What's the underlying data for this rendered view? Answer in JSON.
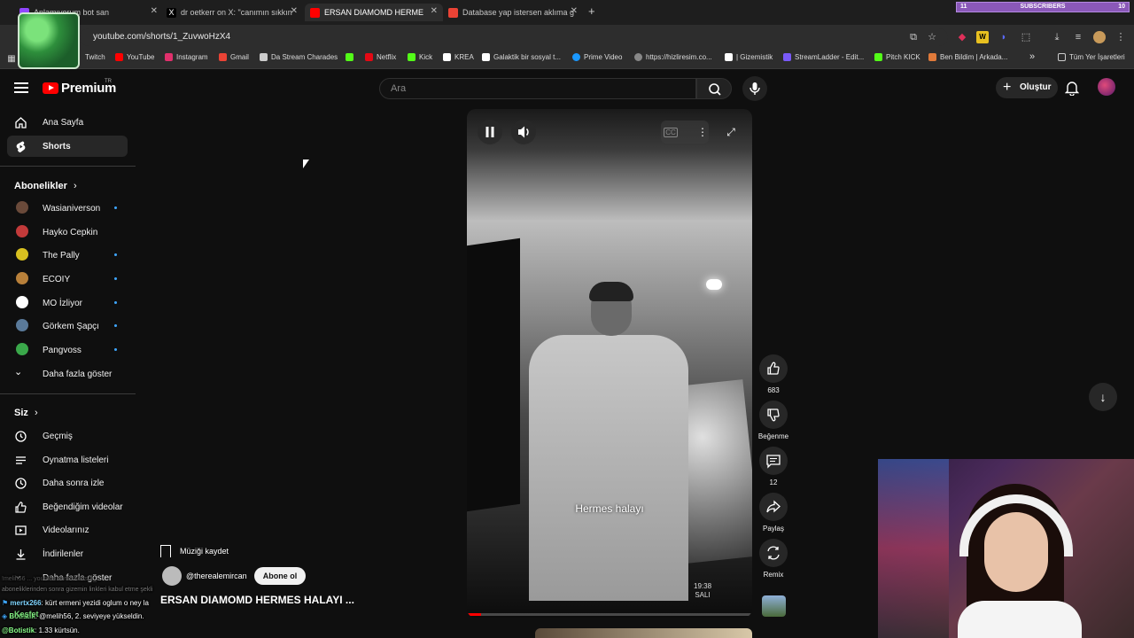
{
  "browser": {
    "tabs": [
      {
        "title": "Anlamıyorum bot san",
        "x": 0
      },
      {
        "title": "dr oetkerr on X: \"canımın sıkkın",
        "x": 0
      },
      {
        "title": "ERSAN DIAMOMD HERME",
        "x": 0
      },
      {
        "title": "Database yap istersen aklıma g",
        "x": 0
      }
    ],
    "new_tab": "+",
    "subscribers_label": "SUBSCRIBERS",
    "subscribers_left": "11",
    "subscribers_right": "10",
    "url": "youtube.com/shorts/1_ZuvwoHzX4",
    "bookmarks": [
      {
        "label": "Twitch",
        "color": "#9146ff"
      },
      {
        "label": "YouTube",
        "color": "#ff0000"
      },
      {
        "label": "Instagram",
        "color": "#e1306c"
      },
      {
        "label": "Gmail",
        "color": "#ea4335"
      },
      {
        "label": "Da Stream Charades",
        "color": "#cccccc"
      },
      {
        "label": "",
        "color": "#53fc18"
      },
      {
        "label": "Netflix",
        "color": "#e50914"
      },
      {
        "label": "Kick",
        "color": "#53fc18"
      },
      {
        "label": "KREA",
        "color": "#ffffff"
      },
      {
        "label": "Galaktik bir sosyal t...",
        "color": "#ffffff"
      },
      {
        "label": "Prime Video",
        "color": "#1a98ff"
      },
      {
        "label": "https://hizliresim.co...",
        "color": "#888888"
      },
      {
        "label": "| Gizemistik",
        "color": "#ffffff"
      },
      {
        "label": "StreamLadder - Edit...",
        "color": "#7a5af8"
      },
      {
        "label": "Pitch KICK",
        "color": "#53fc18"
      },
      {
        "label": "Ben Bildim | Arkada...",
        "color": "#e07a3a"
      }
    ],
    "bookmarks_more": "»",
    "all_bookmarks": "Tüm Yer İşaretleri"
  },
  "header": {
    "logo_text": "Premium",
    "logo_region": "TR",
    "search_placeholder": "Ara",
    "create_label": "Oluştur"
  },
  "sidebar": {
    "main": [
      {
        "label": "Ana Sayfa",
        "icon": "home-icon"
      },
      {
        "label": "Shorts",
        "icon": "shorts-icon"
      }
    ],
    "subs_heading": "Abonelikler",
    "subscriptions": [
      {
        "label": "Wasianiverson",
        "color": "#6a4a3a",
        "dot": true
      },
      {
        "label": "Hayko Cepkin",
        "color": "#c23a3a",
        "dot": false
      },
      {
        "label": "The Pally",
        "color": "#d8c020",
        "dot": true
      },
      {
        "label": "ECOIY",
        "color": "#b8803a",
        "dot": true
      },
      {
        "label": "MO İzliyor",
        "color": "#ffffff",
        "dot": true
      },
      {
        "label": "Görkem Şapçı",
        "color": "#5a7a9a",
        "dot": true
      },
      {
        "label": "Pangvoss",
        "color": "#3aa84a",
        "dot": true
      }
    ],
    "show_more_subs": "Daha fazla göster",
    "you_heading": "Siz",
    "you_items": [
      {
        "label": "Geçmiş",
        "icon": "history-icon"
      },
      {
        "label": "Oynatma listeleri",
        "icon": "playlist-icon"
      },
      {
        "label": "Daha sonra izle",
        "icon": "clock-icon"
      },
      {
        "label": "Beğendiğim videolar",
        "icon": "like-icon"
      },
      {
        "label": "Videolarınız",
        "icon": "video-icon"
      },
      {
        "label": "İndirilenler",
        "icon": "download-icon"
      },
      {
        "label": "Daha fazla göster",
        "icon": "chevron-down-icon"
      }
    ]
  },
  "player": {
    "caption": "Hermes halayı",
    "time": "19:38",
    "day": "SALI",
    "progress": 0.05
  },
  "actions": {
    "likes": "683",
    "dislike_label": "Beğenme",
    "comments": "12",
    "share_label": "Paylaş",
    "remix_label": "Remix"
  },
  "short": {
    "music_label": "Müziği kaydet",
    "channel": "@therealemircan",
    "subscribe_label": "Abone ol",
    "title": "ERSAN DIAMOMD HERMES HALAYI ..."
  },
  "chat": {
    "line1_dim": "!melih56 ... youtube.com/shorts/1_... ",
    "line2_dim": "aboneliklerinden sonra gizemin linkleri kabul etme şekli",
    "line3_user": "mertx266",
    "line3_msg": ": kürt ermeni yezidi oglum o ney la",
    "line4_user": "Botistik",
    "line4_msg": ": @melih56, 2. seviyeye yükseldin.",
    "line5_user": "@Botistik",
    "line5_msg": ": 1.33 kürtsün.",
    "kesfet": "Keşfet"
  }
}
